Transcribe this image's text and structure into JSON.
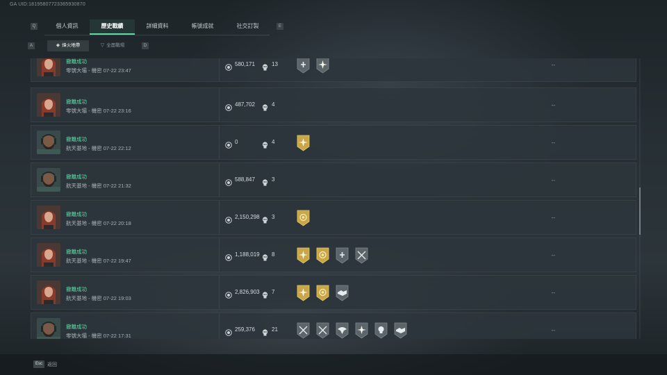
{
  "uid": "GA UID:18195807723365930870",
  "tabs": {
    "left_key": "Q",
    "right_key": "E",
    "items": [
      {
        "label": "個人資訊"
      },
      {
        "label": "歷史戰績"
      },
      {
        "label": "詳細資料"
      },
      {
        "label": "帳號成就"
      },
      {
        "label": "社交訂製"
      }
    ],
    "active_index": 1
  },
  "subtabs": {
    "left_key": "A",
    "right_key": "D",
    "items": [
      {
        "label": "烽火地帶"
      },
      {
        "label": "全面戰場"
      }
    ],
    "active_index": 0
  },
  "matches": [
    {
      "avatar": "female-red-hair",
      "status": "撤離成功",
      "detail": "零號大壩 - 機密 07-22 23:47",
      "money": "580,171",
      "kills": "13",
      "badges": [
        "shield-cross-badge-gray",
        "star-burst-badge-gray"
      ],
      "extra": "--"
    },
    {
      "avatar": "female-red-hair",
      "status": "撤離成功",
      "detail": "零號大壩 - 機密 07-22 23:16",
      "money": "487,702",
      "kills": "4",
      "badges": [],
      "extra": "--"
    },
    {
      "avatar": "bearded-headset-male",
      "status": "撤離成功",
      "detail": "航天基地 - 機密 07-22 22:12",
      "money": "0",
      "kills": "4",
      "badges": [
        "star-burst-badge-gold"
      ],
      "extra": "--"
    },
    {
      "avatar": "bearded-headset-male",
      "status": "撤離成功",
      "detail": "航天基地 - 機密 07-22 21:32",
      "money": "588,847",
      "kills": "3",
      "badges": [],
      "extra": "--"
    },
    {
      "avatar": "female-red-hair",
      "status": "撤離成功",
      "detail": "航天基地 - 機密 07-22 20:18",
      "money": "2,150,298",
      "kills": "3",
      "badges": [
        "medal-badge-gold"
      ],
      "extra": "--"
    },
    {
      "avatar": "female-red-hair",
      "status": "撤離成功",
      "detail": "航天基地 - 機密 07-22 19:47",
      "money": "1,188,019",
      "kills": "8",
      "badges": [
        "star-burst-badge-gold",
        "medal-badge-gold",
        "shield-cross-badge-gray",
        "crossed-guns-badge-gray"
      ],
      "extra": "--"
    },
    {
      "avatar": "female-red-hair",
      "status": "撤離成功",
      "detail": "航天基地 - 機密 07-22 19:03",
      "money": "2,826,903",
      "kills": "7",
      "badges": [
        "star-burst-badge-gold",
        "medal-badge-gold",
        "handshake-badge-gray"
      ],
      "extra": "--"
    },
    {
      "avatar": "bearded-headset-male",
      "status": "撤離成功",
      "detail": "零號大壩 - 機密 07-22 17:31",
      "money": "259,376",
      "kills": "21",
      "badges": [
        "crossed-guns-badge-gray",
        "crossed-guns-badge-gray",
        "eagle-badge-gray",
        "star-burst-badge-gray",
        "skull-badge-gray",
        "handshake-badge-gray"
      ],
      "extra": "--"
    }
  ],
  "footer": {
    "esc_key": "Esc",
    "back_label": "返回"
  },
  "colors": {
    "accent": "#58e0a4",
    "success_text": "#5fe0a8",
    "badge_gold": "#c9a646",
    "badge_gray": "#5c6569"
  }
}
